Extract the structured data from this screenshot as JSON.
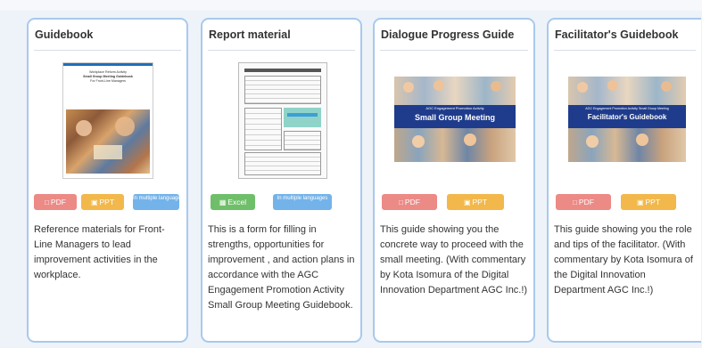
{
  "cards": [
    {
      "title": "Guidebook",
      "cover_lines": [
        "Workplace Reform Activity",
        "Small Group Meeting Guidebook",
        "For Front-Line Managers"
      ],
      "buttons": {
        "pdf": "PDF",
        "ppt": "PPT",
        "lang": "In multiple languages"
      },
      "description": "Reference materials for Front-Line Managers to lead improvement activities in the workplace."
    },
    {
      "title": "Report material",
      "buttons": {
        "excel": "Excel",
        "lang": "In multiple languages"
      },
      "description": "This is a form for filling in strengths, opportunities for improvement , and action plans in accordance with the AGC Engagement Promotion Activity Small Group Meeting Guidebook."
    },
    {
      "title": "Dialogue Progress Guide",
      "banner_sub": "AGC Engagement Promotion Activity",
      "banner_main": "Small Group Meeting",
      "buttons": {
        "pdf": "PDF",
        "ppt": "PPT"
      },
      "description": "This guide showing you the concrete way to proceed with the small meeting. (With commentary by Kota Isomura of the Digital Innovation Department AGC Inc.!)"
    },
    {
      "title": "Facilitator's Guidebook",
      "banner_sub": "AGC Engagement Promotion Activity Small Group Meeting",
      "banner_main": "Facilitator's Guidebook",
      "buttons": {
        "pdf": "PDF",
        "ppt": "PPT"
      },
      "description": "This guide showing you the role and tips of the facilitator. (With commentary by Kota Isomura of the Digital Innovation Department AGC Inc.!)"
    }
  ],
  "icons": {
    "file": "file-icon",
    "slides": "slides-icon",
    "spreadsheet": "spreadsheet-icon"
  },
  "colors": {
    "card_border": "#a9c9ec",
    "pdf": "#ec8a86",
    "ppt": "#f2b84b",
    "excel": "#6fbf6a",
    "lang": "#74b3ea",
    "banner": "#1f3c8c"
  }
}
